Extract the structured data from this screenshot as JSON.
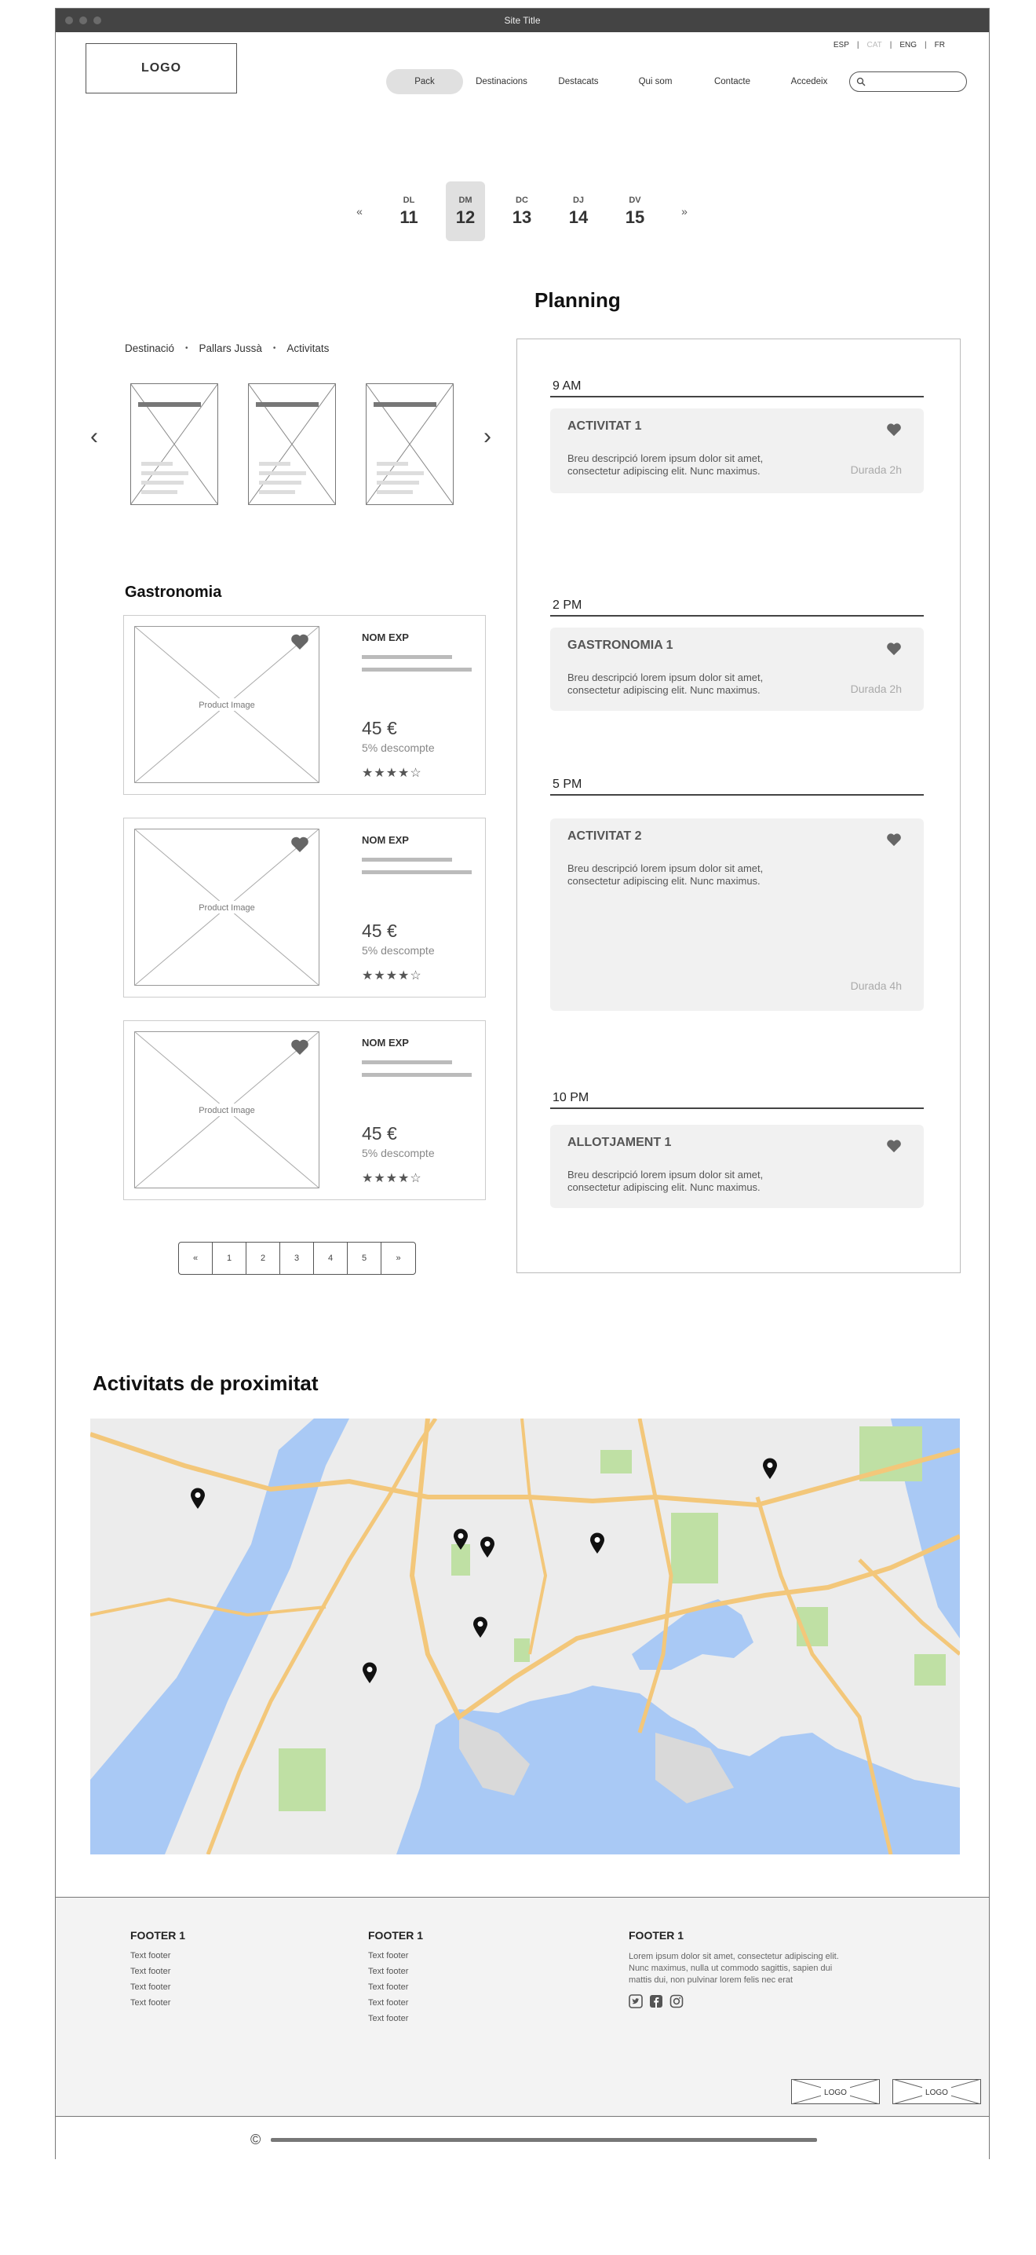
{
  "window": {
    "title": "Site Title"
  },
  "header": {
    "logo": "LOGO",
    "languages": [
      {
        "label": "ESP",
        "disabled": false
      },
      {
        "label": "CAT",
        "disabled": true
      },
      {
        "label": "ENG",
        "disabled": false
      },
      {
        "label": "FR",
        "disabled": false
      }
    ],
    "nav": [
      "Pack",
      "Destinacions",
      "Destacats",
      "Qui som",
      "Contacte",
      "Accedeix"
    ],
    "active_nav": "Pack",
    "search_placeholder": ""
  },
  "day_selector": {
    "prev": "«",
    "next": "»",
    "days": [
      {
        "name": "DL",
        "num": "11"
      },
      {
        "name": "DM",
        "num": "12"
      },
      {
        "name": "DC",
        "num": "13"
      },
      {
        "name": "DJ",
        "num": "14"
      },
      {
        "name": "DV",
        "num": "15"
      }
    ],
    "selected": "DM"
  },
  "breadcrumb": [
    "Destinació",
    "Pallars Jussà",
    "Activitats"
  ],
  "carousel": {
    "prev": "‹",
    "next": "›"
  },
  "gastronomia": {
    "title": "Gastronomia",
    "image_label": "Product Image",
    "products": [
      {
        "name": "NOM EXP",
        "price": "45 €",
        "discount": "5% descompte",
        "stars": "★★★★☆",
        "rating": 4
      },
      {
        "name": "NOM EXP",
        "price": "45 €",
        "discount": "5% descompte",
        "stars": "★★★★☆",
        "rating": 4
      },
      {
        "name": "NOM EXP",
        "price": "45 €",
        "discount": "5% descompte",
        "stars": "★★★★☆",
        "rating": 4
      }
    ]
  },
  "pagination": [
    "«",
    "1",
    "2",
    "3",
    "4",
    "5",
    "»"
  ],
  "planning": {
    "title": "Planning",
    "slots": [
      {
        "time": "9 AM",
        "title": "ACTIVITAT 1",
        "desc": "Breu descripció lorem ipsum dolor sit amet, consectetur adipiscing elit. Nunc maximus.",
        "duration": "Durada 2h"
      },
      {
        "time": "2 PM",
        "title": "GASTRONOMIA 1",
        "desc": "Breu descripció lorem ipsum dolor sit amet, consectetur adipiscing elit. Nunc maximus.",
        "duration": "Durada 2h"
      },
      {
        "time": "5 PM",
        "title": "ACTIVITAT 2",
        "desc": "Breu descripció lorem ipsum dolor sit amet, consectetur adipiscing elit. Nunc maximus.",
        "duration": "Durada 4h"
      },
      {
        "time": "10 PM",
        "title": "ALLOTJAMENT 1",
        "desc": "Breu descripció lorem ipsum dolor sit amet, consectetur adipiscing elit. Nunc maximus.",
        "duration": ""
      }
    ]
  },
  "proximitat": {
    "title": "Activitats de proximitat"
  },
  "footer": {
    "col1": {
      "title": "FOOTER 1",
      "links": [
        "Text footer",
        "Text footer",
        "Text footer",
        "Text footer"
      ]
    },
    "col2": {
      "title": "FOOTER 1",
      "links": [
        "Text footer",
        "Text footer",
        "Text footer",
        "Text footer",
        "Text footer"
      ]
    },
    "col3": {
      "title": "FOOTER 1",
      "text": "Lorem ipsum dolor sit amet, consectetur adipiscing elit. Nunc maximus, nulla ut commodo sagittis, sapien dui mattis dui, non pulvinar lorem felis nec erat"
    },
    "social_icons": [
      "twitter-icon",
      "facebook-icon",
      "instagram-icon"
    ],
    "logos": [
      "LOGO",
      "LOGO"
    ],
    "copyright": "©"
  },
  "colors": {
    "water": "#a9c9f5",
    "roads": "#f3c77a",
    "parks": "#bfe0a4",
    "land": "#ebebeb"
  }
}
